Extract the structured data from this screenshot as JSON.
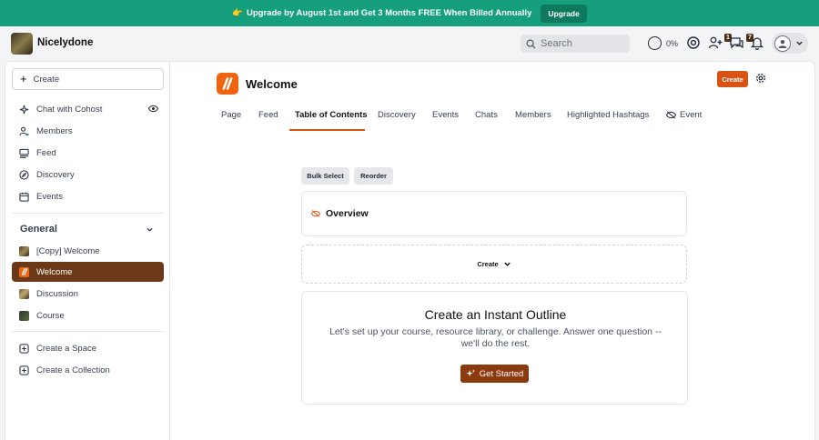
{
  "banner": {
    "emoji": "👉",
    "message": "Upgrade by August 1st and Get 3 Months FREE When Billed Annually",
    "button": "Upgrade"
  },
  "topbar": {
    "brand": "Nicelydone",
    "search_placeholder": "Search",
    "progress": "0%",
    "badges": {
      "invites": "1",
      "messages": "7"
    }
  },
  "sidebar": {
    "create_label": "Create",
    "nav": [
      {
        "label": "Chat with Cohost",
        "icon": "sparkle-icon"
      },
      {
        "label": "Members",
        "icon": "members-icon"
      },
      {
        "label": "Feed",
        "icon": "feed-icon"
      },
      {
        "label": "Discovery",
        "icon": "compass-icon"
      },
      {
        "label": "Events",
        "icon": "calendar-icon"
      }
    ],
    "section_title": "General",
    "spaces": [
      {
        "label": "[Copy] Welcome"
      },
      {
        "label": "Welcome",
        "active": true
      },
      {
        "label": "Discussion"
      },
      {
        "label": "Course"
      }
    ],
    "actions": [
      {
        "label": "Create a Space"
      },
      {
        "label": "Create a Collection"
      }
    ]
  },
  "main": {
    "title": "Welcome",
    "create_button": "Create",
    "tabs": [
      {
        "label": "Page"
      },
      {
        "label": "Feed"
      },
      {
        "label": "Table of Contents",
        "active": true
      },
      {
        "label": "Discovery"
      },
      {
        "label": "Events"
      },
      {
        "label": "Chats"
      },
      {
        "label": "Members"
      },
      {
        "label": "Highlighted Hashtags"
      },
      {
        "label": "Event"
      }
    ],
    "bulk_select": "Bulk Select",
    "reorder": "Reorder",
    "overview": "Overview",
    "create_dropdown": "Create",
    "outline": {
      "title": "Create an Instant Outline",
      "description": "Let's set up your course, resource library, or challenge. Answer one question -- we'll do the rest.",
      "button": "Get Started"
    }
  },
  "colors": {
    "banner": "#159f7d",
    "accent": "#d85314",
    "active_nav": "#6b3917",
    "get_started": "#8a3a0d"
  }
}
